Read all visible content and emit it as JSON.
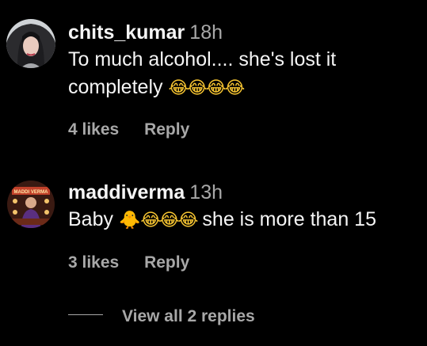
{
  "comments": [
    {
      "username": "chits_kumar",
      "time": "18h",
      "text": "To much alcohol.... she's lost it completely",
      "emojis": "😂😂😂😂",
      "likes": "4 likes",
      "reply": "Reply"
    },
    {
      "username": "maddiverma",
      "time": "13h",
      "text_before": "Baby",
      "emojis_chick": "🐥",
      "emojis": "😂😂😂",
      "text_after": "she is more than 15",
      "likes": "3 likes",
      "reply": "Reply",
      "avatar_label": "MADDI VERMA"
    }
  ],
  "view_replies": "View all 2 replies",
  "colors": {
    "background": "#000000",
    "primary_text": "#f5f5f5",
    "secondary_text": "#a8a8a8"
  }
}
